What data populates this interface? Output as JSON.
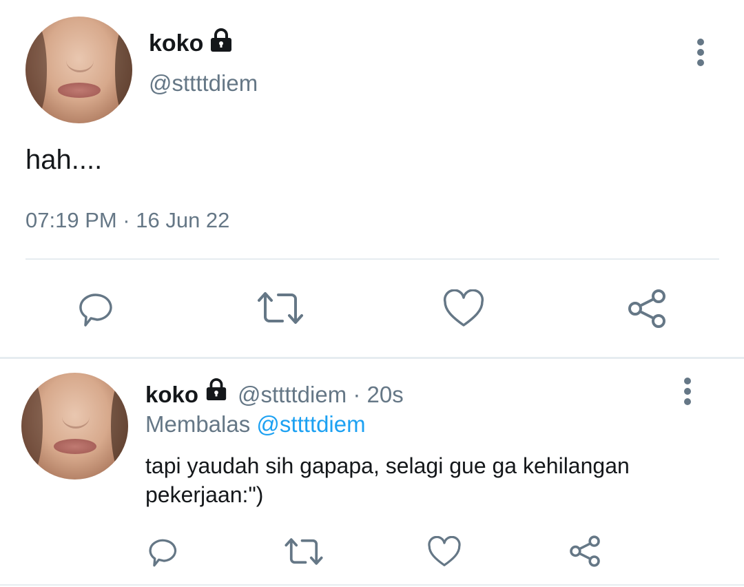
{
  "main_tweet": {
    "name": "koko",
    "handle": "@sttttdiem",
    "text": "hah....",
    "timestamp": "07:19 PM · 16 Jun 22"
  },
  "reply_tweet": {
    "name": "koko",
    "handle_time": "@sttttdiem · 20s",
    "replying_prefix": "Membalas",
    "replying_to": "@sttttdiem",
    "text": "tapi yaudah sih gapapa, selagi gue ga kehilangan pekerjaan:\")"
  },
  "colors": {
    "text": "#14171a",
    "secondary": "#657786",
    "mention": "#1da1f2",
    "divider": "#e6ecf0"
  },
  "icons": [
    "lock-icon",
    "more-vertical-icon",
    "reply-icon",
    "retweet-icon",
    "like-icon",
    "share-icon"
  ]
}
